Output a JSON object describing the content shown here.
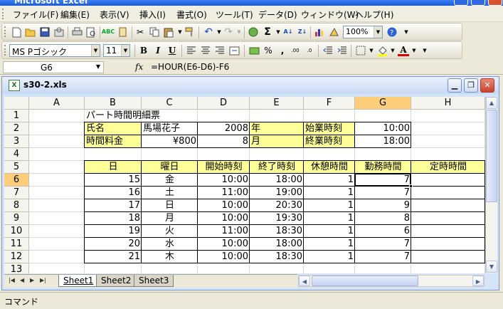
{
  "app": {
    "title": "Microsoft Excel"
  },
  "menu": [
    "ファイル(F)",
    "編集(E)",
    "表示(V)",
    "挿入(I)",
    "書式(O)",
    "ツール(T)",
    "データ(D)",
    "ウィンドウ(W)",
    "ヘルプ(H)"
  ],
  "toolbar": {
    "zoom": "100%",
    "font_name": "MS Pゴシック",
    "font_size": "11",
    "bold": "B",
    "italic": "I",
    "underline": "U",
    "percent": "%",
    "comma": ",",
    "font_color_letter": "A"
  },
  "formula": {
    "name_box": "G6",
    "fx": "fx",
    "text": "=HOUR(E6-D6)-F6"
  },
  "workbook": {
    "title": "s30-2.xls"
  },
  "columns": [
    "A",
    "B",
    "C",
    "D",
    "E",
    "F",
    "G",
    "H"
  ],
  "rows": [
    "1",
    "2",
    "3",
    "4",
    "5",
    "6",
    "7",
    "8",
    "9",
    "10",
    "11",
    "12",
    "13"
  ],
  "cells": {
    "B1": "パート時間明細票",
    "B2": "氏名",
    "C2": "馬場花子",
    "D2": "2008",
    "E2": "年",
    "F2": "始業時刻",
    "G2": "10:00",
    "B3": "時間料金",
    "C3": "¥800",
    "D3": "8",
    "E3": "月",
    "F3": "終業時刻",
    "G3": "18:00",
    "B5": "日",
    "C5": "曜日",
    "D5": "開始時刻",
    "E5": "終了時刻",
    "F5": "休憩時間",
    "G5": "勤務時間",
    "H5": "定時時間",
    "B6": "15",
    "C6": "金",
    "D6": "10:00",
    "E6": "18:00",
    "F6": "1",
    "G6": "7",
    "B7": "16",
    "C7": "土",
    "D7": "11:00",
    "E7": "19:00",
    "F7": "1",
    "G7": "7",
    "B8": "17",
    "C8": "日",
    "D8": "10:00",
    "E8": "20:30",
    "F8": "1",
    "G8": "9",
    "B9": "18",
    "C9": "月",
    "D9": "10:00",
    "E9": "19:30",
    "F9": "1",
    "G9": "8",
    "B10": "19",
    "C10": "火",
    "D10": "11:00",
    "E10": "18:30",
    "F10": "1",
    "G10": "6",
    "B11": "20",
    "C11": "水",
    "D11": "10:00",
    "E11": "18:00",
    "F11": "1",
    "G11": "7",
    "B12": "21",
    "C12": "木",
    "D12": "10:00",
    "E12": "18:30",
    "F12": "1",
    "G12": "7"
  },
  "sheets": [
    "Sheet1",
    "Sheet2",
    "Sheet3"
  ],
  "status": "コマンド",
  "colors": {
    "yellow_fill": "#ffff99",
    "selection_header": "#ffce7a",
    "title_blue": "#3a80f3"
  }
}
